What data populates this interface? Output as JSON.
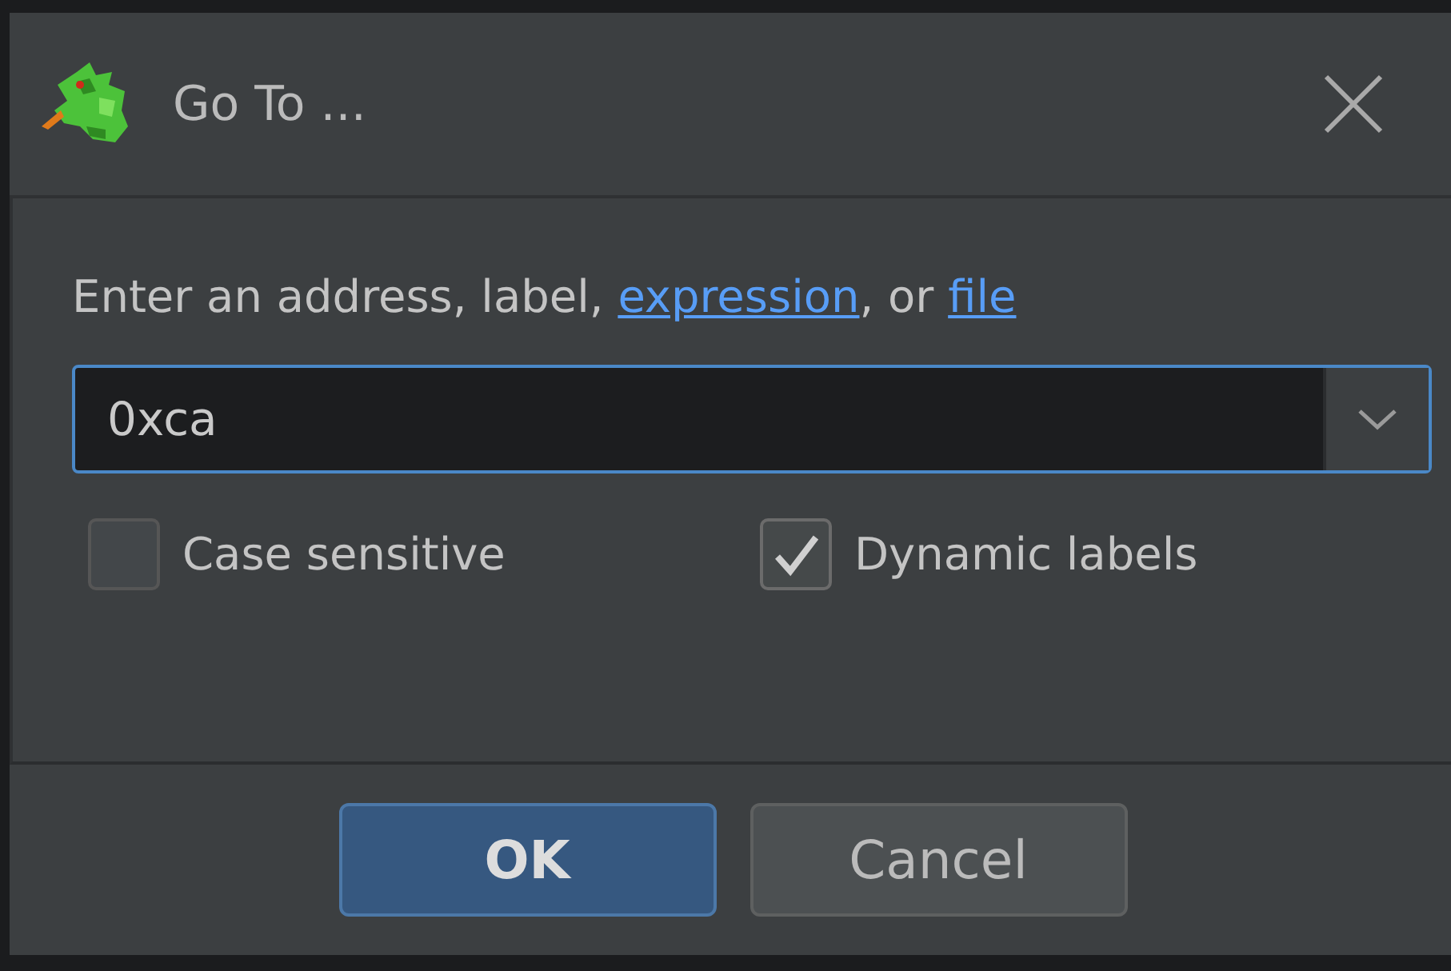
{
  "window": {
    "title": "Go To ..."
  },
  "prompt": [
    {
      "kind": "text",
      "text": "Enter an address, label, "
    },
    {
      "kind": "link",
      "text": "expression"
    },
    {
      "kind": "text",
      "text": ", or "
    },
    {
      "kind": "link",
      "text": "file"
    }
  ],
  "combo": {
    "value": "0xca"
  },
  "options": [
    {
      "label": "Case sensitive",
      "checked": false
    },
    {
      "label": "Dynamic labels",
      "checked": true
    }
  ],
  "buttons": [
    {
      "label": "OK",
      "kind": "primary"
    },
    {
      "label": "Cancel",
      "kind": "secondary"
    }
  ]
}
